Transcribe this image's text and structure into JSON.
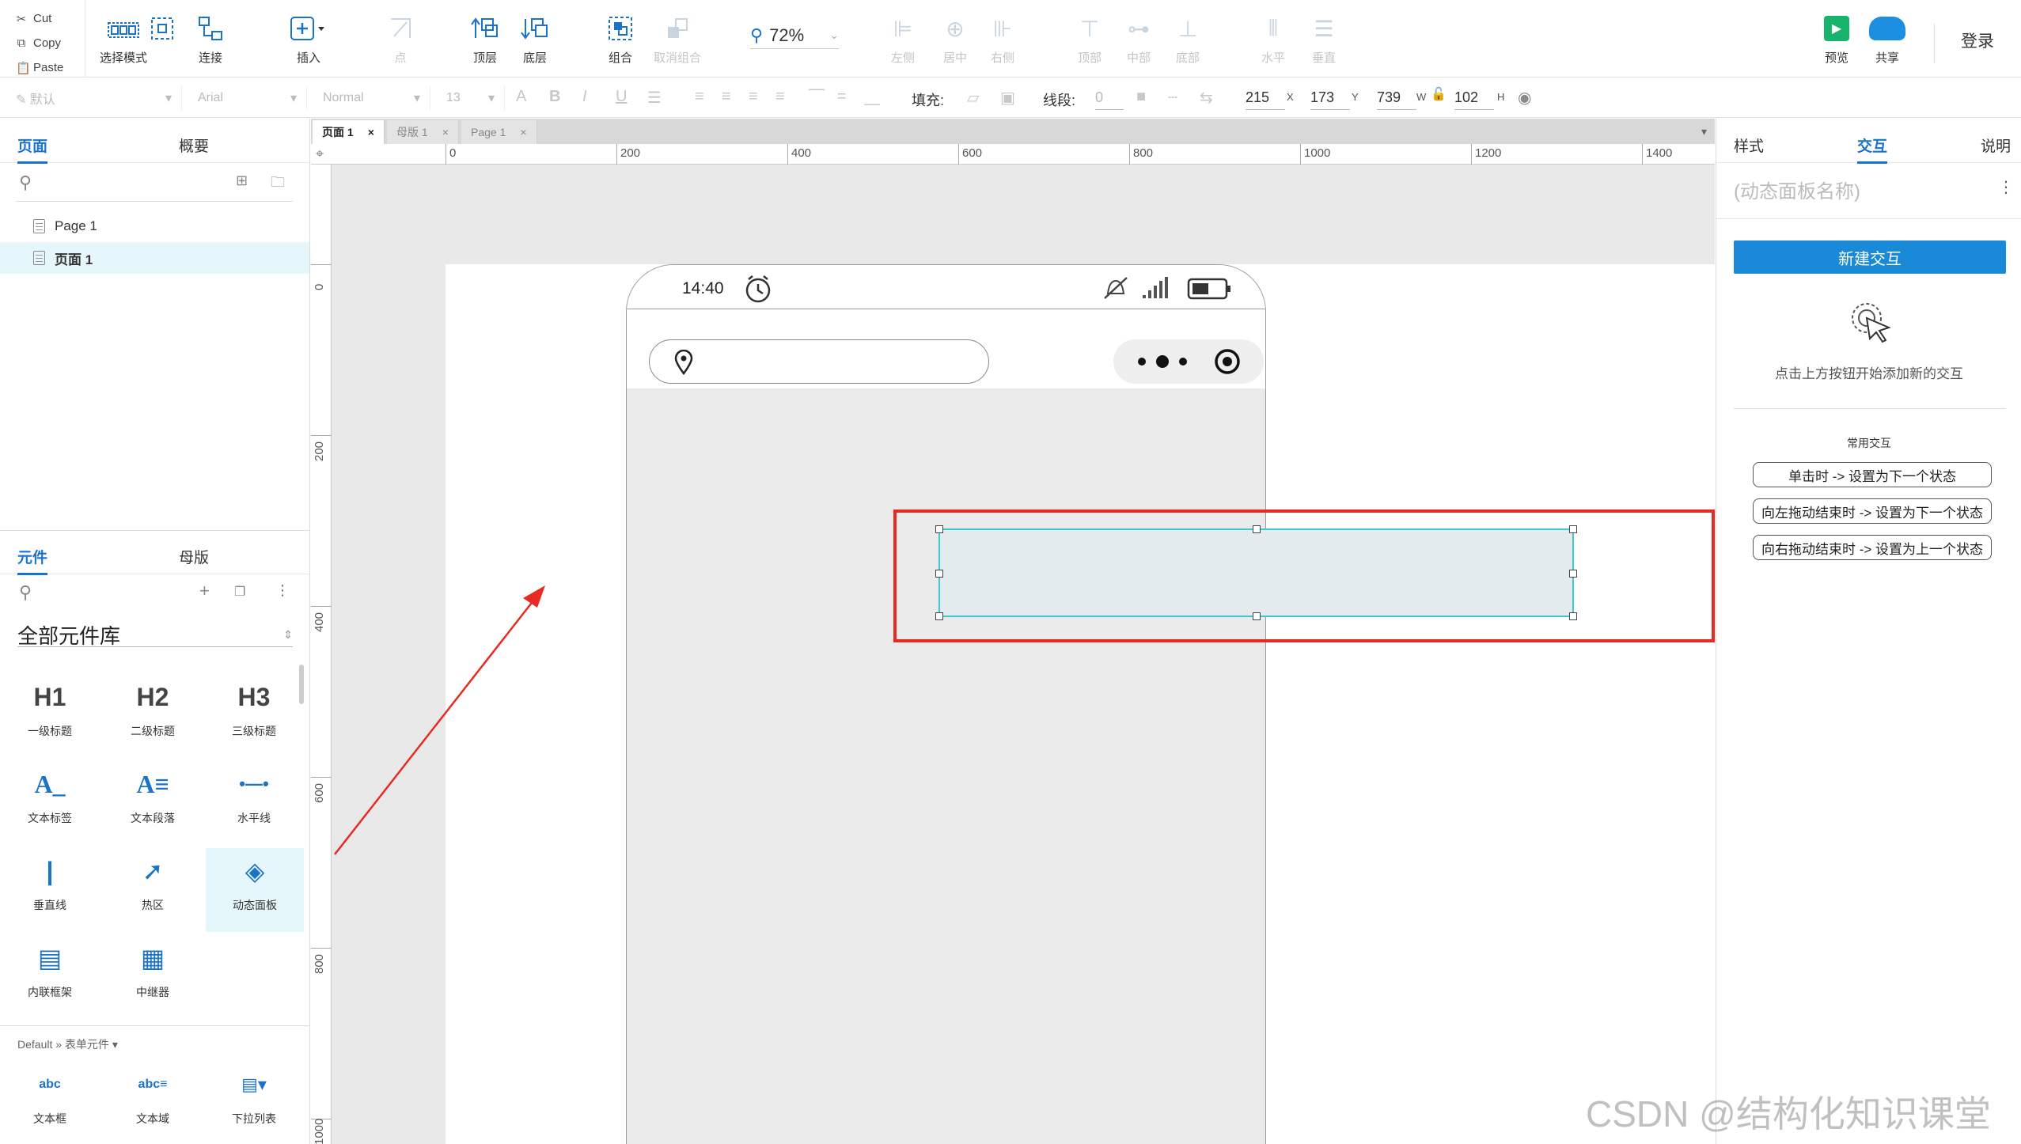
{
  "toolbar": {
    "clipboard": [
      {
        "label": "Cut",
        "icon": "scissors-icon"
      },
      {
        "label": "Copy",
        "icon": "copy-icon"
      },
      {
        "label": "Paste",
        "icon": "paste-icon"
      }
    ],
    "buttons": [
      {
        "id": "select-mode",
        "label": "选择模式"
      },
      {
        "id": "connect",
        "label": "连接"
      },
      {
        "id": "insert",
        "label": "插入"
      },
      {
        "id": "point",
        "label": "点"
      },
      {
        "id": "bring-front",
        "label": "顶层"
      },
      {
        "id": "send-back",
        "label": "底层"
      },
      {
        "id": "group",
        "label": "组合"
      },
      {
        "id": "ungroup",
        "label": "取消组合"
      },
      {
        "id": "align-left",
        "label": "左侧"
      },
      {
        "id": "align-center",
        "label": "居中"
      },
      {
        "id": "align-right",
        "label": "右侧"
      },
      {
        "id": "align-top",
        "label": "顶部"
      },
      {
        "id": "align-middle",
        "label": "中部"
      },
      {
        "id": "align-bottom",
        "label": "底部"
      },
      {
        "id": "distribute-h",
        "label": "水平"
      },
      {
        "id": "distribute-v",
        "label": "垂直"
      },
      {
        "id": "preview",
        "label": "预览"
      },
      {
        "id": "share",
        "label": "共享"
      }
    ],
    "zoom": "72%",
    "login": "登录"
  },
  "formatbar": {
    "style": "默认",
    "font": "Arial",
    "weight": "Normal",
    "size": "13",
    "fill_label": "填充:",
    "stroke_label": "线段:",
    "stroke_value": "0",
    "x": "215",
    "x_unit": "X",
    "y": "173",
    "y_unit": "Y",
    "w": "739",
    "w_unit": "W",
    "h": "102",
    "h_unit": "H"
  },
  "leftpanel": {
    "tabs": [
      "页面",
      "概要"
    ],
    "pages": [
      "Page 1",
      "页面 1"
    ],
    "lib_tabs": [
      "元件",
      "母版"
    ],
    "library": "全部元件库",
    "widgets": [
      {
        "icon": "H1",
        "label": "一级标题"
      },
      {
        "icon": "H2",
        "label": "二级标题"
      },
      {
        "icon": "H3",
        "label": "三级标题"
      },
      {
        "icon": "A_",
        "label": "文本标签"
      },
      {
        "icon": "A≡",
        "label": "文本段落"
      },
      {
        "icon": "•—•",
        "label": "水平线"
      },
      {
        "icon": "|",
        "label": "垂直线"
      },
      {
        "icon": "➚",
        "label": "热区"
      },
      {
        "icon": "◈",
        "label": "动态面板"
      },
      {
        "icon": "▤",
        "label": "内联框架"
      },
      {
        "icon": "▦",
        "label": "中继器"
      }
    ],
    "form_section": "Default » 表单元件 ▾",
    "form_widgets": [
      {
        "icon": "abc",
        "label": "文本框"
      },
      {
        "icon": "abc≡",
        "label": "文本域"
      },
      {
        "icon": "▤▾",
        "label": "下拉列表"
      }
    ]
  },
  "canvas": {
    "doc_tabs": [
      "页面 1",
      "母版 1",
      "Page 1"
    ],
    "ruler_h": [
      "0",
      "200",
      "400",
      "600",
      "800",
      "1000",
      "1200",
      "1400"
    ],
    "ruler_v": [
      "0",
      "200",
      "400",
      "600",
      "800",
      "1000"
    ],
    "phone_time": "14:40"
  },
  "rightpanel": {
    "tabs": [
      "样式",
      "交互",
      "说明"
    ],
    "panel_name_placeholder": "(动态面板名称)",
    "new_interaction": "新建交互",
    "hint": "点击上方按钮开始添加新的交互",
    "common_title": "常用交互",
    "common": [
      "单击时 -> 设置为下一个状态",
      "向左拖动结束时 -> 设置为下一个状态",
      "向右拖动结束时 -> 设置为上一个状态"
    ]
  },
  "watermark": "CSDN @结构化知识课堂",
  "colors": {
    "accent": "#1a73c8",
    "highlight": "#e82a24",
    "selection": "#40c8d2"
  }
}
